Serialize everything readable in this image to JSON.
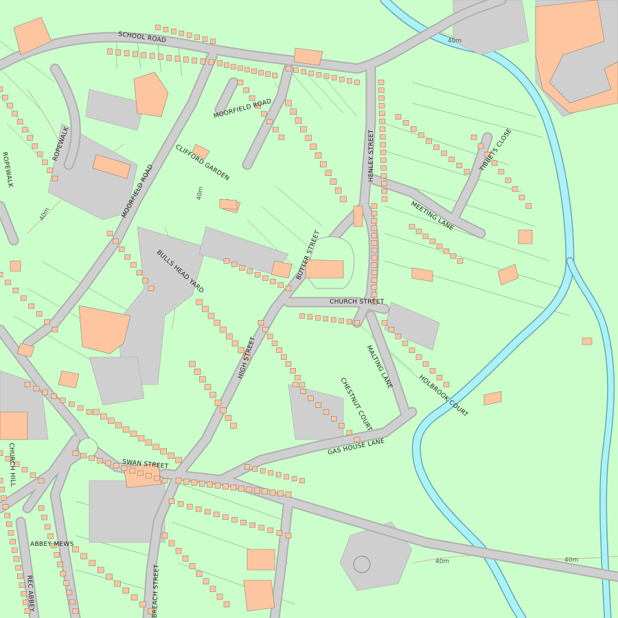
{
  "colors": {
    "land": "#ccfecc",
    "building": "#fdc6a0",
    "road": "#cfcfcf",
    "river": "#a9f3f7"
  },
  "labels": {
    "school_road": "SCHOOL ROAD",
    "moorfield_road_n": "MOORFIELD ROAD",
    "moorfield_road_w": "MOORFIELD ROAD",
    "ropewalk_1": "ROPEWALK",
    "ropewalk_2": "ROPEWALK",
    "clifford_garden": "CLIFFORD GARDEN",
    "henley_street": "HENLEY STREET",
    "tibbets_close": "TIBBETS CLOSE",
    "meeting_lane": "MEETING LANE",
    "butter_street": "BUTTER STREET",
    "bulls_head_yard": "BULLS HEAD YARD",
    "church_street": "CHURCH STREET",
    "high_street": "HIGH STREET",
    "malting_lane": "MALTING LANE",
    "gas_house_lane": "GAS HOUSE LANE",
    "chestnut_court": "CHESTNUT COURT",
    "holbrook_court": "HOLBROOK COURT",
    "swan_street": "SWAN STREET",
    "abbey_mews": "ABBEY MEWS",
    "church_hill": "CHURCH HILL",
    "rec_abbey": "REC ABBEY",
    "breach_street": "BREACH STREET"
  },
  "contours": {
    "c1": "40m",
    "c2": "40m",
    "c3": "40m",
    "c4": "40m",
    "c5": "40m"
  }
}
